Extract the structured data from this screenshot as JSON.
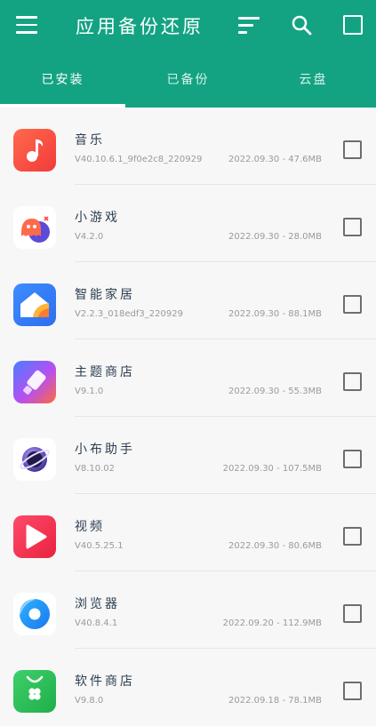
{
  "header": {
    "title": "应用备份还原",
    "menu_icon": "menu-icon",
    "sort_icon": "sort-icon",
    "search_icon": "search-icon",
    "select_all_icon": "checkbox-outline-icon",
    "background_color": "#13a382"
  },
  "tabs": [
    {
      "label": "已安装",
      "active": true
    },
    {
      "label": "已备份",
      "active": false
    },
    {
      "label": "云盘",
      "active": false
    }
  ],
  "apps": [
    {
      "name": "音乐",
      "version": "V40.10.6.1_9f0e2c8_220929",
      "meta": "2022.09.30 - 47.6MB",
      "icon": "music-icon",
      "checked": false
    },
    {
      "name": "小游戏",
      "version": "V4.2.0",
      "meta": "2022.09.30 - 28.0MB",
      "icon": "game-icon",
      "checked": false
    },
    {
      "name": "智能家居",
      "version": "V2.2.3_018edf3_220929",
      "meta": "2022.09.30 - 88.1MB",
      "icon": "smart-home-icon",
      "checked": false
    },
    {
      "name": "主题商店",
      "version": "V9.1.0",
      "meta": "2022.09.30 - 55.3MB",
      "icon": "theme-store-icon",
      "checked": false
    },
    {
      "name": "小布助手",
      "version": "V8.10.02",
      "meta": "2022.09.30 - 107.5MB",
      "icon": "assistant-icon",
      "checked": false
    },
    {
      "name": "视频",
      "version": "V40.5.25.1",
      "meta": "2022.09.30 - 80.6MB",
      "icon": "video-icon",
      "checked": false
    },
    {
      "name": "浏览器",
      "version": "V40.8.4.1",
      "meta": "2022.09.20 - 112.9MB",
      "icon": "browser-icon",
      "checked": false
    },
    {
      "name": "软件商店",
      "version": "V9.8.0",
      "meta": "2022.09.18 - 78.1MB",
      "icon": "app-store-icon",
      "checked": false
    }
  ]
}
